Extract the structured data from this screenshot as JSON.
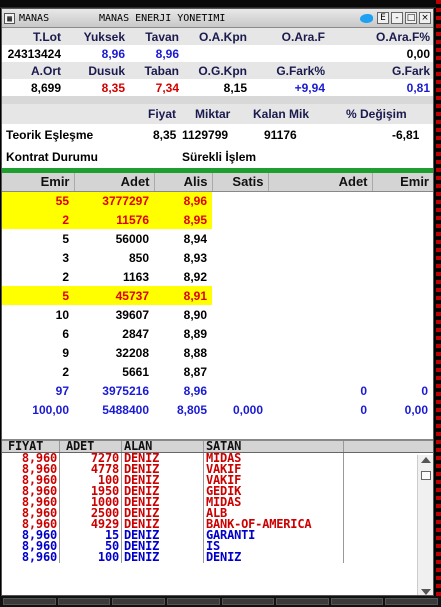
{
  "window": {
    "symbol": "MANAS",
    "name": "MANAS ENERJI YONETIMI",
    "buttons": [
      "E",
      "-",
      "□",
      "×"
    ]
  },
  "summary": {
    "row1_headers": [
      "T.Lot",
      "Yuksek",
      "Tavan",
      "O.A.Kpn",
      "O.Ara.F",
      "O.Ara.F%"
    ],
    "row1_values": [
      "24313424",
      "8,96",
      "8,96",
      "",
      "",
      "0,00"
    ],
    "row2_headers": [
      "A.Ort",
      "Dusuk",
      "Taban",
      "O.G.Kpn",
      "G.Fark%",
      "G.Fark"
    ],
    "row2_values": [
      "8,699",
      "8,35",
      "7,34",
      "8,15",
      "+9,94",
      "0,81"
    ]
  },
  "theoretical": {
    "headers": [
      "Fiyat",
      "Miktar",
      "Kalan Mik",
      "% Değişim"
    ],
    "label": "Teorik Eşleşme",
    "fiyat": "8,35",
    "miktar": "1129799",
    "kalan": "91176",
    "degisim": "-6,81",
    "contract_label": "Kontrat Durumu",
    "contract_value": "Sürekli İşlem"
  },
  "depth": {
    "headers": [
      "Emir",
      "Adet",
      "Alis",
      "Satis",
      "Adet",
      "Emir"
    ],
    "rows": [
      {
        "emir": "55",
        "adet": "3777297",
        "alis": "8,96",
        "hl": true
      },
      {
        "emir": "2",
        "adet": "11576",
        "alis": "8,95",
        "hl": true
      },
      {
        "emir": "5",
        "adet": "56000",
        "alis": "8,94",
        "hl": false
      },
      {
        "emir": "3",
        "adet": "850",
        "alis": "8,93",
        "hl": false
      },
      {
        "emir": "2",
        "adet": "1163",
        "alis": "8,92",
        "hl": false
      },
      {
        "emir": "5",
        "adet": "45737",
        "alis": "8,91",
        "hl": true
      },
      {
        "emir": "10",
        "adet": "39607",
        "alis": "8,90",
        "hl": false
      },
      {
        "emir": "6",
        "adet": "2847",
        "alis": "8,89",
        "hl": false
      },
      {
        "emir": "9",
        "adet": "32208",
        "alis": "8,88",
        "hl": false
      },
      {
        "emir": "2",
        "adet": "5661",
        "alis": "8,87",
        "hl": false
      }
    ],
    "total1": [
      "97",
      "3975216",
      "8,96",
      "",
      "0",
      "0"
    ],
    "total2": [
      "100,00",
      "5488400",
      "8,805",
      "0,000",
      "0",
      "0,00"
    ]
  },
  "trades": {
    "headers": [
      "FIYAT",
      "ADET",
      "ALAN",
      "SATAN"
    ],
    "rows": [
      {
        "fiyat": "8,960",
        "adet": "7270",
        "alan": "DENIZ",
        "satan": "MIDAS",
        "color": "#cc0000"
      },
      {
        "fiyat": "8,960",
        "adet": "4778",
        "alan": "DENIZ",
        "satan": "VAKIF",
        "color": "#cc0000"
      },
      {
        "fiyat": "8,960",
        "adet": "100",
        "alan": "DENIZ",
        "satan": "VAKIF",
        "color": "#cc0000"
      },
      {
        "fiyat": "8,960",
        "adet": "1950",
        "alan": "DENIZ",
        "satan": "GEDIK",
        "color": "#cc0000"
      },
      {
        "fiyat": "8,960",
        "adet": "1000",
        "alan": "DENIZ",
        "satan": "MIDAS",
        "color": "#cc0000"
      },
      {
        "fiyat": "8,960",
        "adet": "2500",
        "alan": "DENIZ",
        "satan": "ALB",
        "color": "#cc0000"
      },
      {
        "fiyat": "8,960",
        "adet": "4929",
        "alan": "DENIZ",
        "satan": "BANK-OF-AMERICA",
        "color": "#cc0000"
      },
      {
        "fiyat": "8,960",
        "adet": "15",
        "alan": "DENIZ",
        "satan": "GARANTI",
        "color": "#0000cc"
      },
      {
        "fiyat": "8,960",
        "adet": "50",
        "alan": "DENIZ",
        "satan": "IS",
        "color": "#0000cc"
      },
      {
        "fiyat": "8,960",
        "adet": "100",
        "alan": "DENIZ",
        "satan": "DENIZ",
        "color": "#0000cc"
      }
    ]
  }
}
